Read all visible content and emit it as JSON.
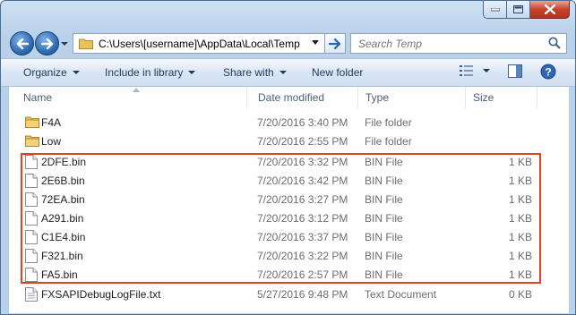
{
  "window": {
    "path": "C:\\Users\\[username]\\AppData\\Local\\Temp",
    "search_placeholder": "Search Temp"
  },
  "toolbar": {
    "organize": "Organize",
    "include": "Include in library",
    "share": "Share with",
    "newfolder": "New folder"
  },
  "columns": {
    "name": "Name",
    "date": "Date modified",
    "type": "Type",
    "size": "Size"
  },
  "files": [
    {
      "name": "F4A",
      "date": "7/20/2016 3:40 PM",
      "type": "File folder",
      "size": "",
      "icon": "folder-icon"
    },
    {
      "name": "Low",
      "date": "7/20/2016 2:55 PM",
      "type": "File folder",
      "size": "",
      "icon": "folder-icon"
    },
    {
      "name": "2DFE.bin",
      "date": "7/20/2016 3:32 PM",
      "type": "BIN File",
      "size": "1 KB",
      "icon": "file-icon"
    },
    {
      "name": "2E6B.bin",
      "date": "7/20/2016 3:42 PM",
      "type": "BIN File",
      "size": "1 KB",
      "icon": "file-icon"
    },
    {
      "name": "72EA.bin",
      "date": "7/20/2016 3:27 PM",
      "type": "BIN File",
      "size": "1 KB",
      "icon": "file-icon"
    },
    {
      "name": "A291.bin",
      "date": "7/20/2016 3:12 PM",
      "type": "BIN File",
      "size": "1 KB",
      "icon": "file-icon"
    },
    {
      "name": "C1E4.bin",
      "date": "7/20/2016 3:37 PM",
      "type": "BIN File",
      "size": "1 KB",
      "icon": "file-icon"
    },
    {
      "name": "F321.bin",
      "date": "7/20/2016 3:22 PM",
      "type": "BIN File",
      "size": "1 KB",
      "icon": "file-icon"
    },
    {
      "name": "FA5.bin",
      "date": "7/20/2016 2:57 PM",
      "type": "BIN File",
      "size": "1 KB",
      "icon": "file-icon"
    },
    {
      "name": "FXSAPIDebugLogFile.txt",
      "date": "5/27/2016 9:48 PM",
      "type": "Text Document",
      "size": "0 KB",
      "icon": "text-file-icon"
    }
  ],
  "colors": {
    "highlight_border": "#e0411f",
    "title_gradient": "#b9d1ea",
    "folder_yellow": "#e8c35a"
  }
}
